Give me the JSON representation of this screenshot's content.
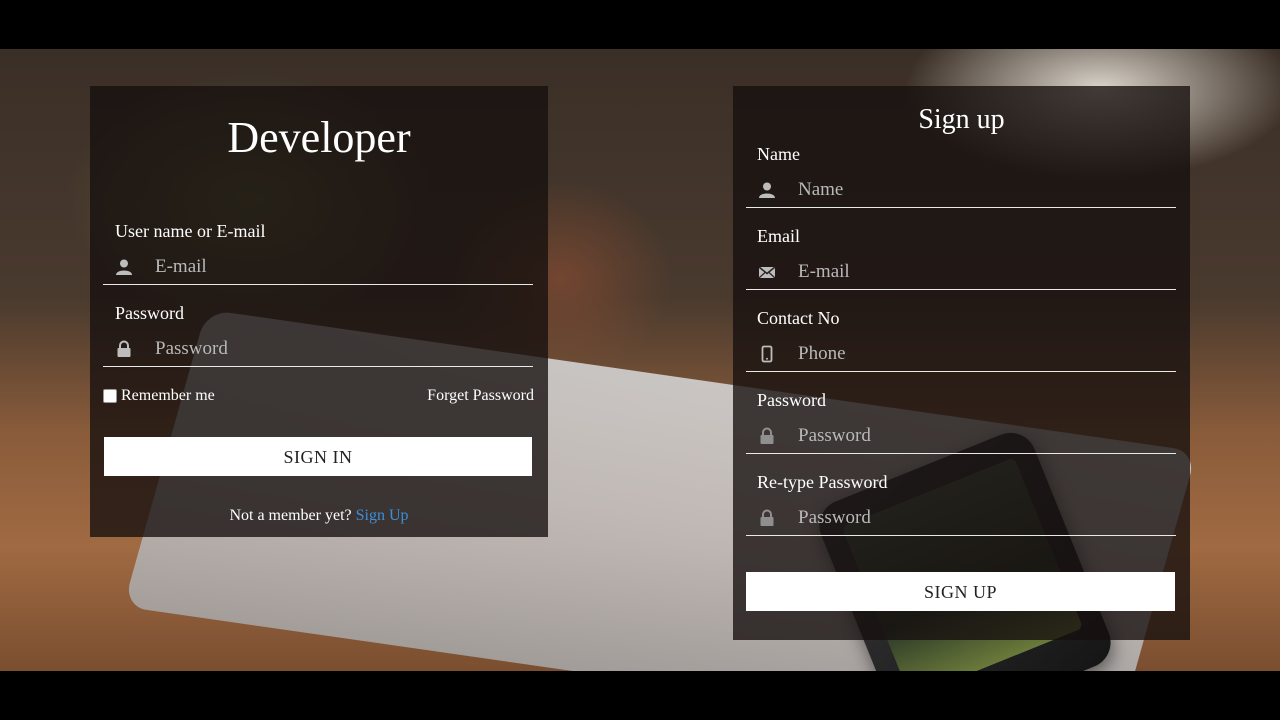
{
  "login": {
    "title": "Developer",
    "username_label": "User name or E-mail",
    "username_placeholder": "E-mail",
    "password_label": "Password",
    "password_placeholder": "Password",
    "remember_label": "Remember me",
    "forget_label": "Forget Password",
    "signin_label": "SIGN IN",
    "not_member_text": "Not a member yet?",
    "signup_link": "Sign Up"
  },
  "signup": {
    "title": "Sign up",
    "fields": [
      {
        "label": "Name",
        "placeholder": "Name",
        "icon": "user-icon"
      },
      {
        "label": "Email",
        "placeholder": "E-mail",
        "icon": "envelope-icon"
      },
      {
        "label": "Contact No",
        "placeholder": "Phone",
        "icon": "phone-icon"
      },
      {
        "label": "Password",
        "placeholder": "Password",
        "icon": "lock-icon"
      },
      {
        "label": "Re-type Password",
        "placeholder": "Password",
        "icon": "lock-icon"
      }
    ],
    "signup_label": "SIGN UP"
  },
  "colors": {
    "panel_bg": "#16100e",
    "link": "#3d8fd9",
    "button_bg": "#ffffff"
  }
}
